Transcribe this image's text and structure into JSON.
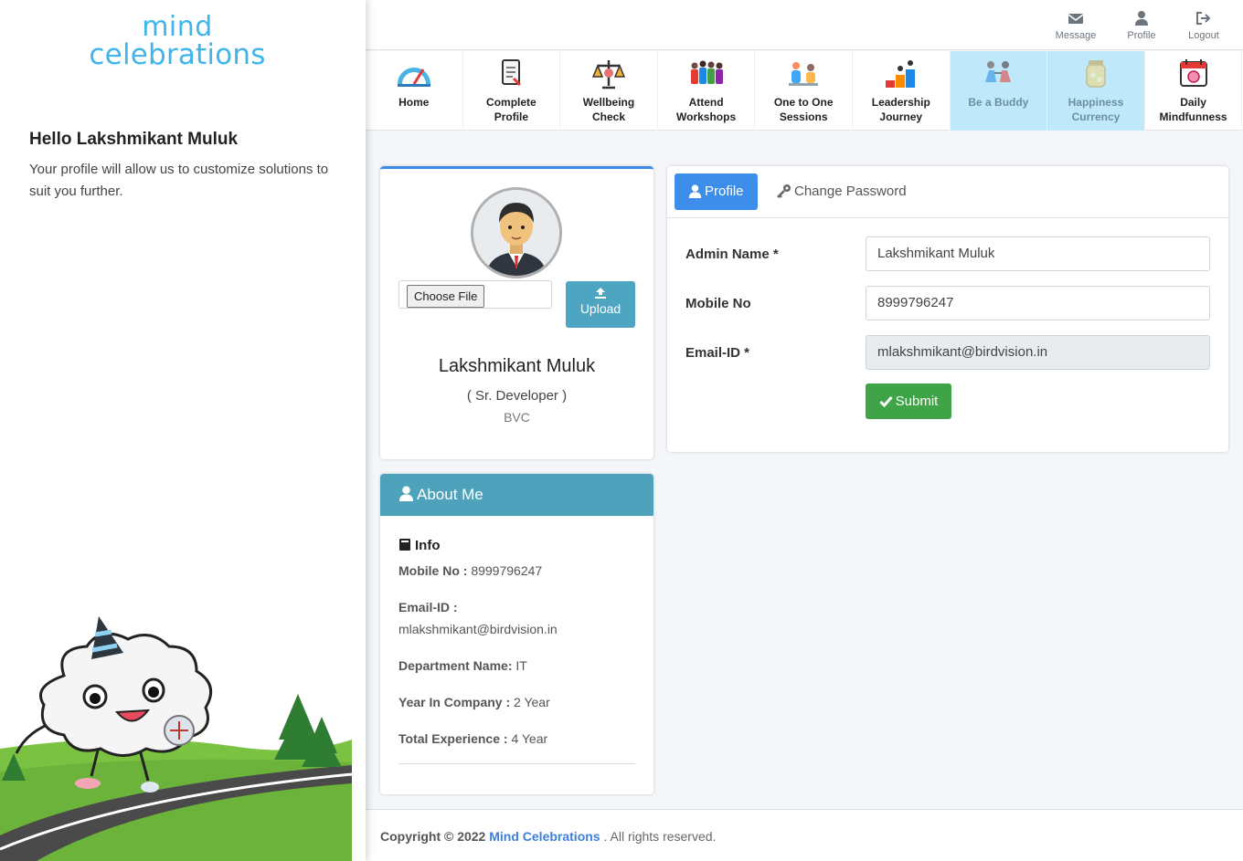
{
  "sidebar": {
    "logo_line1": "mind",
    "logo_line2": "celebrations",
    "greeting": "Hello Lakshmikant Muluk",
    "subtitle": "Your profile will allow us to customize solutions to suit you further."
  },
  "topbar": {
    "message": "Message",
    "profile": "Profile",
    "logout": "Logout"
  },
  "nav": {
    "items": [
      {
        "label": "Home",
        "icon": "speedometer-icon"
      },
      {
        "label": "Complete\nProfile",
        "icon": "clipboard-icon"
      },
      {
        "label": "Wellbeing\nCheck",
        "icon": "balance-scale-icon"
      },
      {
        "label": "Attend\nWorkshops",
        "icon": "group-icon"
      },
      {
        "label": "One to One\nSessions",
        "icon": "conversation-icon"
      },
      {
        "label": "Leadership\nJourney",
        "icon": "steps-icon"
      },
      {
        "label": "Be a Buddy",
        "icon": "buddy-icon",
        "active": true
      },
      {
        "label": "Happiness\nCurrency",
        "icon": "jar-icon",
        "active": true
      },
      {
        "label": "Daily\nMindfunness",
        "icon": "calendar-brain-icon"
      }
    ]
  },
  "profile_card": {
    "choose_file": "Choose File",
    "upload": "Upload",
    "name": "Lakshmikant Muluk",
    "role": "( Sr. Developer )",
    "org": "BVC"
  },
  "about": {
    "title": "About Me",
    "info_title": "Info",
    "mobile_label": "Mobile No :",
    "mobile_value": "8999796247",
    "email_label": "Email-ID :",
    "email_value": "mlakshmikant@birdvision.in",
    "department_label": "Department Name:",
    "department_value": "IT",
    "year_label": "Year In Company :",
    "year_value": "2 Year",
    "experience_label": "Total Experience :",
    "experience_value": "4 Year"
  },
  "form": {
    "tab_profile": "Profile",
    "tab_password": "Change Password",
    "admin_name_label": "Admin Name *",
    "admin_name_value": "Lakshmikant Muluk",
    "mobile_label": "Mobile No",
    "mobile_value": "8999796247",
    "email_label": "Email-ID *",
    "email_value": "mlakshmikant@birdvision.in",
    "submit": "Submit"
  },
  "footer": {
    "prefix": "Copyright © 2022",
    "brand": "Mind Celebrations",
    "suffix": ". All rights reserved."
  },
  "colors": {
    "accent": "#3d8eea",
    "about_header": "#4fa2bb",
    "submit": "#3fa447",
    "active_nav": "#bfe8fb",
    "logo": "#3fb5ec"
  }
}
